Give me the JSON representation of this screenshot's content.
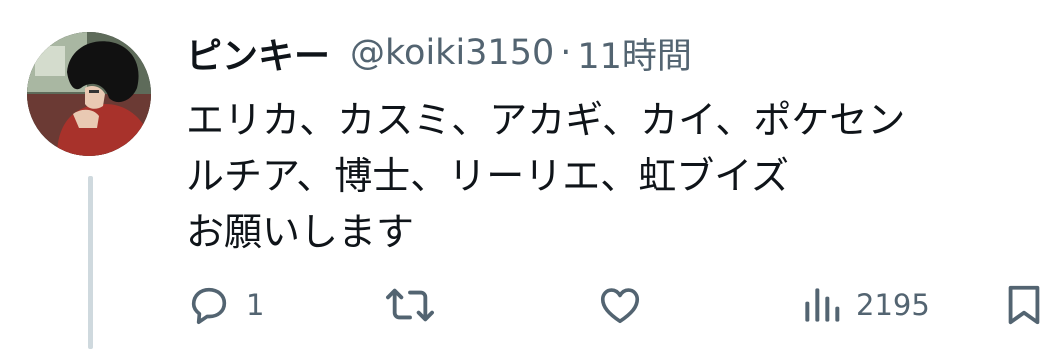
{
  "post": {
    "display_name": "ピンキー",
    "handle": "@koiki3150",
    "separator": "·",
    "time": "11時間",
    "lines": [
      "エリカ、カスミ、アカギ、カイ、ポケセン",
      "ルチア、博士、リーリエ、虹ブイズ",
      "お願いします"
    ]
  },
  "actions": {
    "reply_icon": "reply-icon",
    "reply_count": "1",
    "repost_icon": "repost-icon",
    "like_icon": "heart-icon",
    "views_icon": "views-icon",
    "views_count": "2195",
    "bookmark_icon": "bookmark-icon"
  },
  "colors": {
    "text": "#0f1419",
    "muted": "#536471",
    "thread_line": "#cfd9de"
  }
}
